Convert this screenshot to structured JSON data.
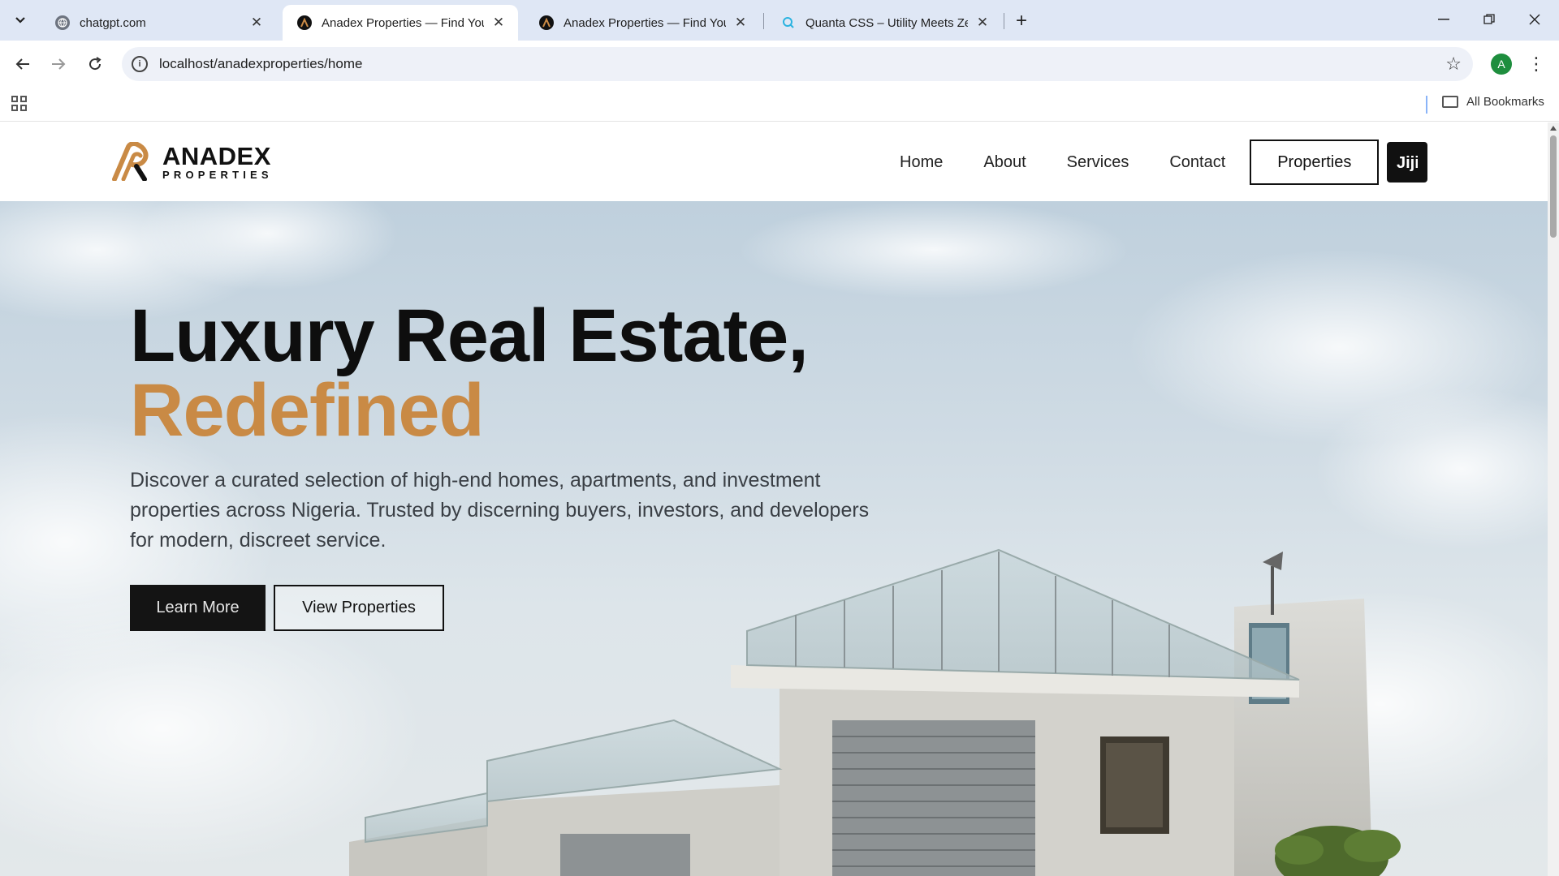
{
  "browser": {
    "tabs": [
      {
        "title": "chatgpt.com",
        "favicon": "globe-icon",
        "active": false
      },
      {
        "title": "Anadex Properties — Find Your",
        "favicon": "anadex-icon",
        "active": true
      },
      {
        "title": "Anadex Properties — Find Your",
        "favicon": "anadex-icon",
        "active": false
      },
      {
        "title": "Quanta CSS – Utility Meets Zen",
        "favicon": "quanta-icon",
        "active": false
      }
    ],
    "url": "localhost/anadexproperties/home",
    "profile_initial": "A",
    "bookmarks_label": "All Bookmarks"
  },
  "site": {
    "logo": {
      "name": "ANADEX",
      "sub": "PROPERTIES"
    },
    "nav": [
      "Home",
      "About",
      "Services",
      "Contact"
    ],
    "properties_button": "Properties",
    "jiji_button": "Jiji"
  },
  "hero": {
    "title_line1": "Luxury Real Estate,",
    "title_line2": "Redefined",
    "description": "Discover a curated selection of high-end homes, apartments, and investment properties across Nigeria. Trusted by discerning buyers, investors, and developers for modern, discreet service.",
    "learn_more": "Learn More",
    "view_properties": "View Properties"
  },
  "colors": {
    "accent": "#c98a45",
    "dark": "#111111",
    "tabstrip": "#dfe7f5"
  }
}
